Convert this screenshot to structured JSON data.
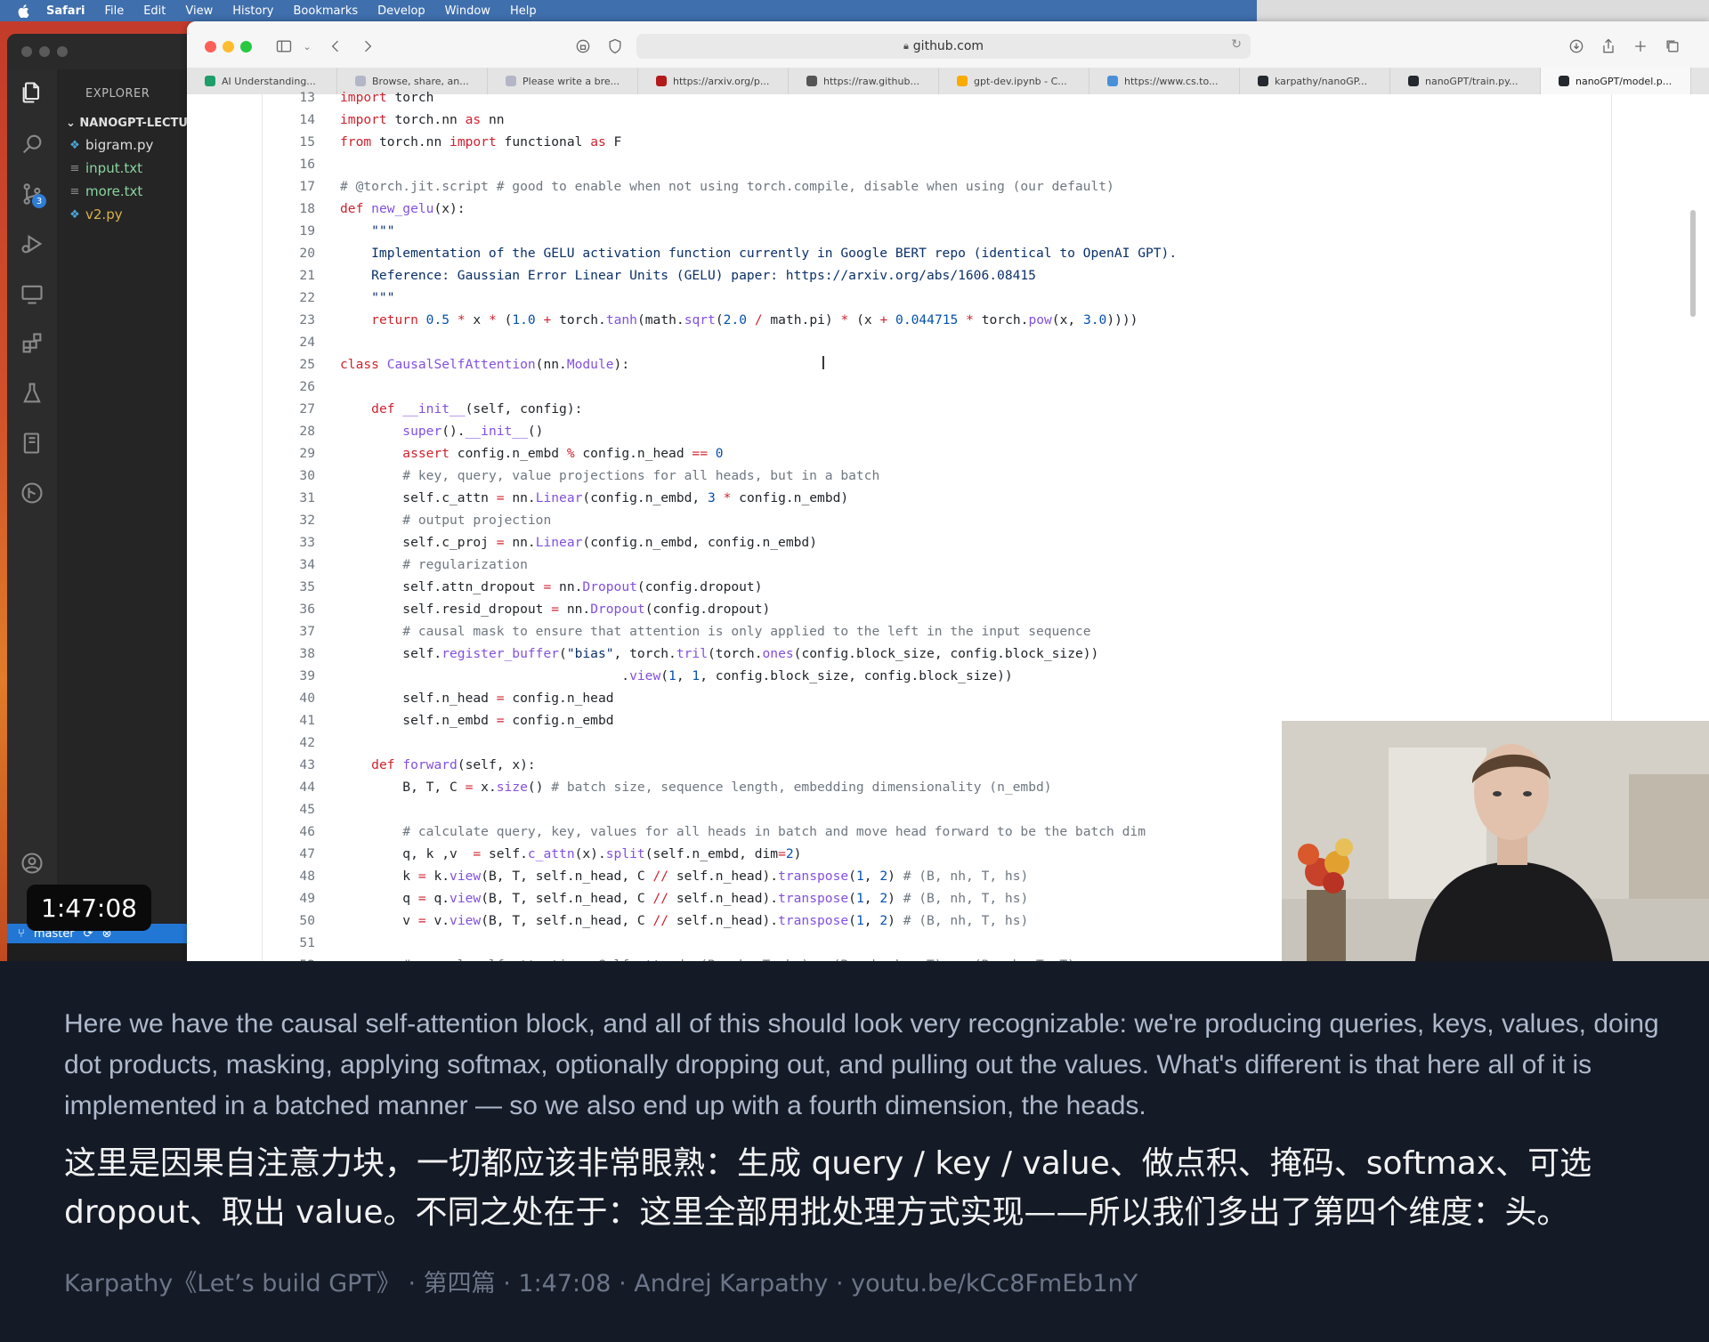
{
  "menubar": {
    "app_name": "Safari",
    "items": [
      "File",
      "Edit",
      "View",
      "History",
      "Bookmarks",
      "Develop",
      "Window",
      "Help"
    ]
  },
  "vscode": {
    "explorer_title": "EXPLORER",
    "project": "NANOGPT-LECTU",
    "files": [
      {
        "name": "bigram.py",
        "type": "py"
      },
      {
        "name": "input.txt",
        "type": "txt"
      },
      {
        "name": "more.txt",
        "type": "txt"
      },
      {
        "name": "v2.py",
        "type": "v2"
      }
    ],
    "scm_badge": "3",
    "branch": "master"
  },
  "video_timestamp": "1:47:08",
  "safari": {
    "address": "github.com",
    "tabs": [
      {
        "label": "AI Understanding...",
        "icon_color": "#1f9e6a"
      },
      {
        "label": "Browse, share, an...",
        "icon_color": "#b3b6c8"
      },
      {
        "label": "Please write a bre...",
        "icon_color": "#b3b6c8"
      },
      {
        "label": "https://arxiv.org/p...",
        "icon_color": "#b31b1b"
      },
      {
        "label": "https://raw.github...",
        "icon_color": "#555555"
      },
      {
        "label": "gpt-dev.ipynb - C...",
        "icon_color": "#f9ab00"
      },
      {
        "label": "https://www.cs.to...",
        "icon_color": "#4a90d9"
      },
      {
        "label": "karpathy/nanoGP...",
        "icon_color": "#24292f"
      },
      {
        "label": "nanoGPT/train.py...",
        "icon_color": "#24292f"
      },
      {
        "label": "nanoGPT/model.p...",
        "icon_color": "#24292f"
      }
    ]
  },
  "code_lines": [
    {
      "n": "13",
      "html": "<span class=\"kw\">import</span> torch"
    },
    {
      "n": "14",
      "html": "<span class=\"kw\">import</span> torch.nn <span class=\"kw\">as</span> nn"
    },
    {
      "n": "15",
      "html": "<span class=\"kw\">from</span> torch.nn <span class=\"kw\">import</span> functional <span class=\"kw\">as</span> F"
    },
    {
      "n": "16",
      "html": ""
    },
    {
      "n": "17",
      "html": "<span class=\"cm\"># @torch.jit.script # good to enable when not using torch.compile, disable when using (our default)</span>"
    },
    {
      "n": "18",
      "html": "<span class=\"kw\">def</span> <span class=\"fn\">new_gelu</span>(x):"
    },
    {
      "n": "19",
      "html": "    <span class=\"str\">\"\"\"</span>"
    },
    {
      "n": "20",
      "html": "<span class=\"str\">    Implementation of the GELU activation function currently in Google BERT repo (identical to OpenAI GPT).</span>"
    },
    {
      "n": "21",
      "html": "<span class=\"str\">    Reference: Gaussian Error Linear Units (GELU) paper: https://arxiv.org/abs/1606.08415</span>"
    },
    {
      "n": "22",
      "html": "<span class=\"str\">    \"\"\"</span>"
    },
    {
      "n": "23",
      "html": "    <span class=\"kw\">return</span> <span class=\"num\">0.5</span> <span class=\"kw\">*</span> x <span class=\"kw\">*</span> (<span class=\"num\">1.0</span> <span class=\"kw\">+</span> torch.<span class=\"fn\">tanh</span>(math.<span class=\"fn\">sqrt</span>(<span class=\"num\">2.0</span> <span class=\"kw\">/</span> math.pi) <span class=\"kw\">*</span> (x <span class=\"kw\">+</span> <span class=\"num\">0.044715</span> <span class=\"kw\">*</span> torch.<span class=\"fn\">pow</span>(x, <span class=\"num\">3.0</span>))))"
    },
    {
      "n": "24",
      "html": ""
    },
    {
      "n": "25",
      "html": "<span class=\"kw\">class</span> <span class=\"fn\">CausalSelfAttention</span>(nn.<span class=\"fn\">Module</span>):"
    },
    {
      "n": "26",
      "html": ""
    },
    {
      "n": "27",
      "html": "    <span class=\"kw\">def</span> <span class=\"fn\">__init__</span>(self, config):"
    },
    {
      "n": "28",
      "html": "        <span class=\"fn\">super</span>().<span class=\"fn\">__init__</span>()"
    },
    {
      "n": "29",
      "html": "        <span class=\"kw\">assert</span> config.n_embd <span class=\"kw\">%</span> config.n_head <span class=\"kw\">==</span> <span class=\"num\">0</span>"
    },
    {
      "n": "30",
      "html": "        <span class=\"cm\"># key, query, value projections for all heads, but in a batch</span>"
    },
    {
      "n": "31",
      "html": "        self.c_attn <span class=\"kw\">=</span> nn.<span class=\"fn\">Linear</span>(config.n_embd, <span class=\"num\">3</span> <span class=\"kw\">*</span> config.n_embd)"
    },
    {
      "n": "32",
      "html": "        <span class=\"cm\"># output projection</span>"
    },
    {
      "n": "33",
      "html": "        self.c_proj <span class=\"kw\">=</span> nn.<span class=\"fn\">Linear</span>(config.n_embd, config.n_embd)"
    },
    {
      "n": "34",
      "html": "        <span class=\"cm\"># regularization</span>"
    },
    {
      "n": "35",
      "html": "        self.attn_dropout <span class=\"kw\">=</span> nn.<span class=\"fn\">Dropout</span>(config.dropout)"
    },
    {
      "n": "36",
      "html": "        self.resid_dropout <span class=\"kw\">=</span> nn.<span class=\"fn\">Dropout</span>(config.dropout)"
    },
    {
      "n": "37",
      "html": "        <span class=\"cm\"># causal mask to ensure that attention is only applied to the left in the input sequence</span>"
    },
    {
      "n": "38",
      "html": "        self.<span class=\"fn\">register_buffer</span>(<span class=\"str\">\"bias\"</span>, torch.<span class=\"fn\">tril</span>(torch.<span class=\"fn\">ones</span>(config.block_size, config.block_size))"
    },
    {
      "n": "39",
      "html": "                                    .<span class=\"fn\">view</span>(<span class=\"num\">1</span>, <span class=\"num\">1</span>, config.block_size, config.block_size))"
    },
    {
      "n": "40",
      "html": "        self.n_head <span class=\"kw\">=</span> config.n_head"
    },
    {
      "n": "41",
      "html": "        self.n_embd <span class=\"kw\">=</span> config.n_embd"
    },
    {
      "n": "42",
      "html": ""
    },
    {
      "n": "43",
      "html": "    <span class=\"kw\">def</span> <span class=\"fn\">forward</span>(self, x):"
    },
    {
      "n": "44",
      "html": "        B, T, C <span class=\"kw\">=</span> x.<span class=\"fn\">size</span>() <span class=\"cm\"># batch size, sequence length, embedding dimensionality (n_embd)</span>"
    },
    {
      "n": "45",
      "html": ""
    },
    {
      "n": "46",
      "html": "        <span class=\"cm\"># calculate query, key, values for all heads in batch and move head forward to be the batch dim</span>"
    },
    {
      "n": "47",
      "html": "        q, k ,v  <span class=\"kw\">=</span> self.<span class=\"fn\">c_attn</span>(x).<span class=\"fn\">split</span>(self.n_embd, dim<span class=\"kw\">=</span><span class=\"num\">2</span>)"
    },
    {
      "n": "48",
      "html": "        k <span class=\"kw\">=</span> k.<span class=\"fn\">view</span>(B, T, self.n_head, C <span class=\"kw\">//</span> self.n_head).<span class=\"fn\">transpose</span>(<span class=\"num\">1</span>, <span class=\"num\">2</span>) <span class=\"cm\"># (B, nh, T, hs)</span>"
    },
    {
      "n": "49",
      "html": "        q <span class=\"kw\">=</span> q.<span class=\"fn\">view</span>(B, T, self.n_head, C <span class=\"kw\">//</span> self.n_head).<span class=\"fn\">transpose</span>(<span class=\"num\">1</span>, <span class=\"num\">2</span>) <span class=\"cm\"># (B, nh, T, hs)</span>"
    },
    {
      "n": "50",
      "html": "        v <span class=\"kw\">=</span> v.<span class=\"fn\">view</span>(B, T, self.n_head, C <span class=\"kw\">//</span> self.n_head).<span class=\"fn\">transpose</span>(<span class=\"num\">1</span>, <span class=\"num\">2</span>) <span class=\"cm\"># (B, nh, T, hs)</span>"
    },
    {
      "n": "51",
      "html": ""
    },
    {
      "n": "52",
      "html": "        <span class=\"cm\"># causal self-attention; Self-attend: (B, nh, T, hs) x (B, nh, hs, T) -&gt; (B, nh, T, T)</span>"
    }
  ],
  "subtitles": {
    "english": "Here we have the causal self-attention block, and all of this should look very recognizable: we're producing queries, keys, values, doing dot products, masking, applying softmax, optionally dropping out, and pulling out the values. What's different is that here all of it is implemented in a batched manner — so we also end up with a fourth dimension, the heads.",
    "chinese": "这里是因果自注意力块，一切都应该非常眼熟：生成 query / key / value、做点积、掩码、softmax、可选 dropout、取出 value。不同之处在于：这里全部用批处理方式实现——所以我们多出了第四个维度：头。",
    "meta": "Karpathy《Let’s build GPT》 · 第四篇 · 1:47:08 · Andrej Karpathy · youtu.be/kCc8FmEb1nY"
  },
  "colors": {
    "menubar": "#3f6fad",
    "subtitle_bg": "#141a26",
    "keyword": "#cf222e",
    "function": "#8250df",
    "comment": "#6e7781",
    "number": "#0550ae"
  }
}
